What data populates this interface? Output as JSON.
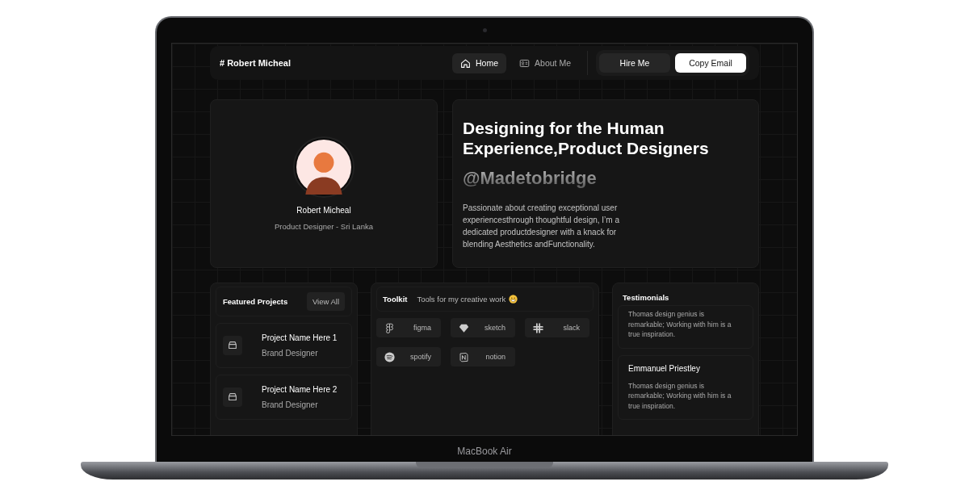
{
  "device": {
    "label": "MacBook Air"
  },
  "nav": {
    "brand": "# Robert Micheal",
    "links": [
      {
        "label": "Home",
        "selected": true
      },
      {
        "label": "About Me",
        "selected": false
      }
    ],
    "buttons": [
      {
        "label": "Hire Me",
        "kind": "secondary"
      },
      {
        "label": "Copy Email",
        "kind": "primary"
      }
    ]
  },
  "profile": {
    "name": "Robert Micheal",
    "role": "Product Designer - Sri Lanka"
  },
  "hero": {
    "headline": "Designing for the Human Experience,Product Designers",
    "handle": "@Madetobridge",
    "bio": "Passionate about creating exceptional user experiencesthrough thoughtful design, I’m a dedicated productdesigner with a knack for blending Aesthetics andFunctionality."
  },
  "projects": {
    "title": "Featured Projects",
    "action": "View All",
    "items": [
      {
        "name": "Project Name Here 1",
        "role": "Brand Designer"
      },
      {
        "name": "Project Name Here 2",
        "role": "Brand Designer"
      }
    ]
  },
  "toolkit": {
    "title": "Toolkit",
    "subtitle": "Tools for my creative work",
    "tools": [
      {
        "name": "figma"
      },
      {
        "name": "sketch"
      },
      {
        "name": "slack"
      },
      {
        "name": "spotify"
      },
      {
        "name": "notion"
      }
    ]
  },
  "testimonials": {
    "title": "Testimonials",
    "items": [
      {
        "quote": "Thomas design genius is remarkable; Working with him is a true inspiration."
      },
      {
        "name": "Emmanuel Priestley",
        "quote": "Thomas design genius is remarkable; Working with him is a true inspiration."
      }
    ]
  }
}
